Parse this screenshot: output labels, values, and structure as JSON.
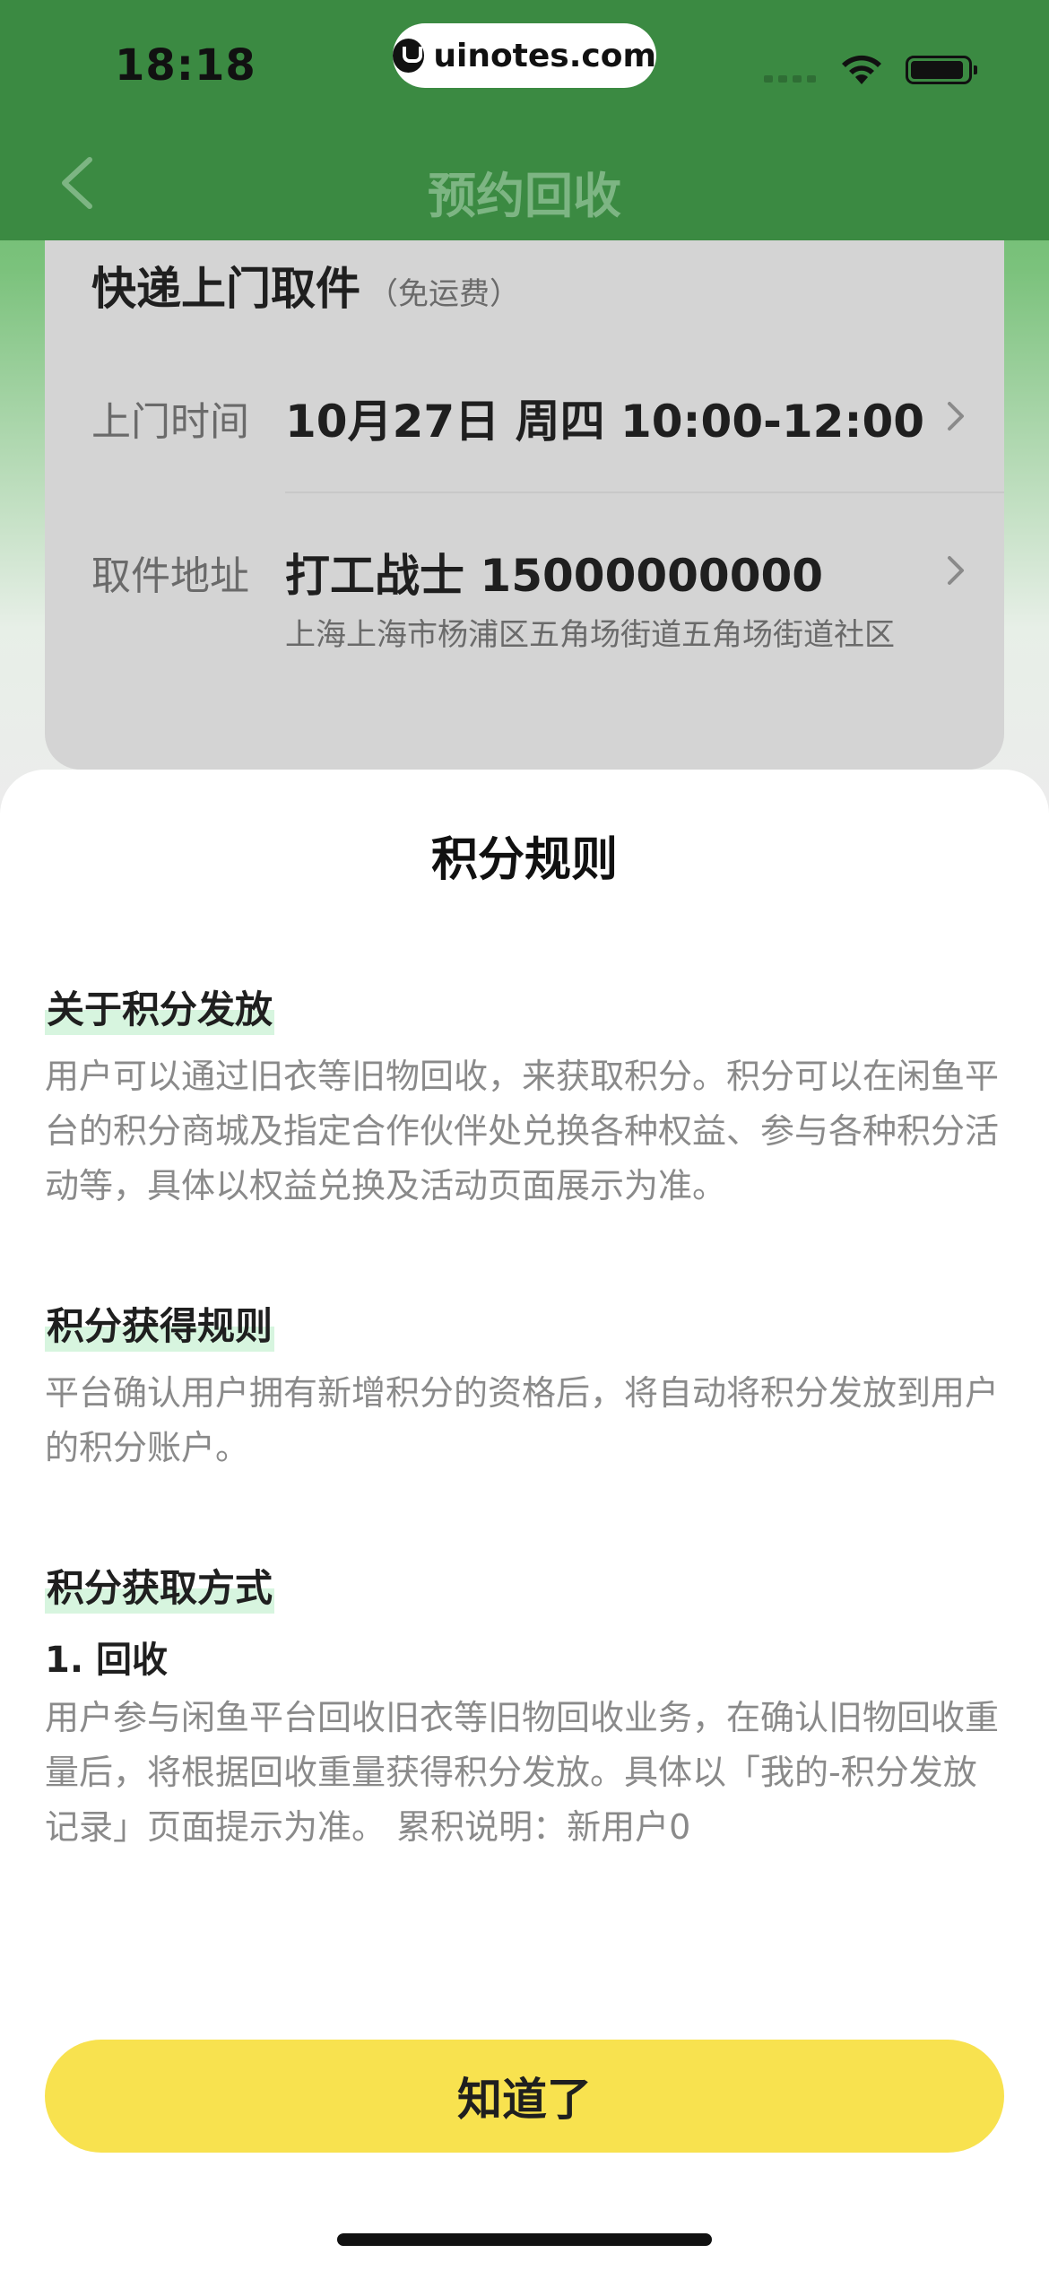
{
  "status_bar": {
    "time": "18:18",
    "url": "uinotes.com"
  },
  "nav": {
    "title": "预约回收"
  },
  "pickup": {
    "title": "快递上门取件",
    "note": "（免运费）",
    "time_label": "上门时间",
    "time_value": "10月27日 周四 10:00-12:00",
    "address_label": "取件地址",
    "address_name": "打工战士 15000000000",
    "address_detail": "上海上海市杨浦区五角场街道五角场街道社区"
  },
  "sheet": {
    "title": "积分规则",
    "sections": [
      {
        "heading": "关于积分发放",
        "text": "用户可以通过旧衣等旧物回收，来获取积分。积分可以在闲鱼平台的积分商城及指定合作伙伴处兑换各种权益、参与各种积分活动等，具体以权益兑换及活动页面展示为准。"
      },
      {
        "heading": "积分获得规则",
        "text": "平台确认用户拥有新增积分的资格后，将自动将积分发放到用户的积分账户。"
      },
      {
        "heading": "积分获取方式",
        "subheading": "1. 回收",
        "text": "用户参与闲鱼平台回收旧衣等旧物回收业务，在确认旧物回收重量后，将根据回收重量获得积分发放。具体以「我的-积分发放记录」页面提示为准。 累积说明：新用户0"
      }
    ],
    "confirm_label": "知道了"
  },
  "colors": {
    "status_green": "#3b8a42",
    "button_yellow": "#f8e24f",
    "heading_highlight": "#d7f5df"
  }
}
